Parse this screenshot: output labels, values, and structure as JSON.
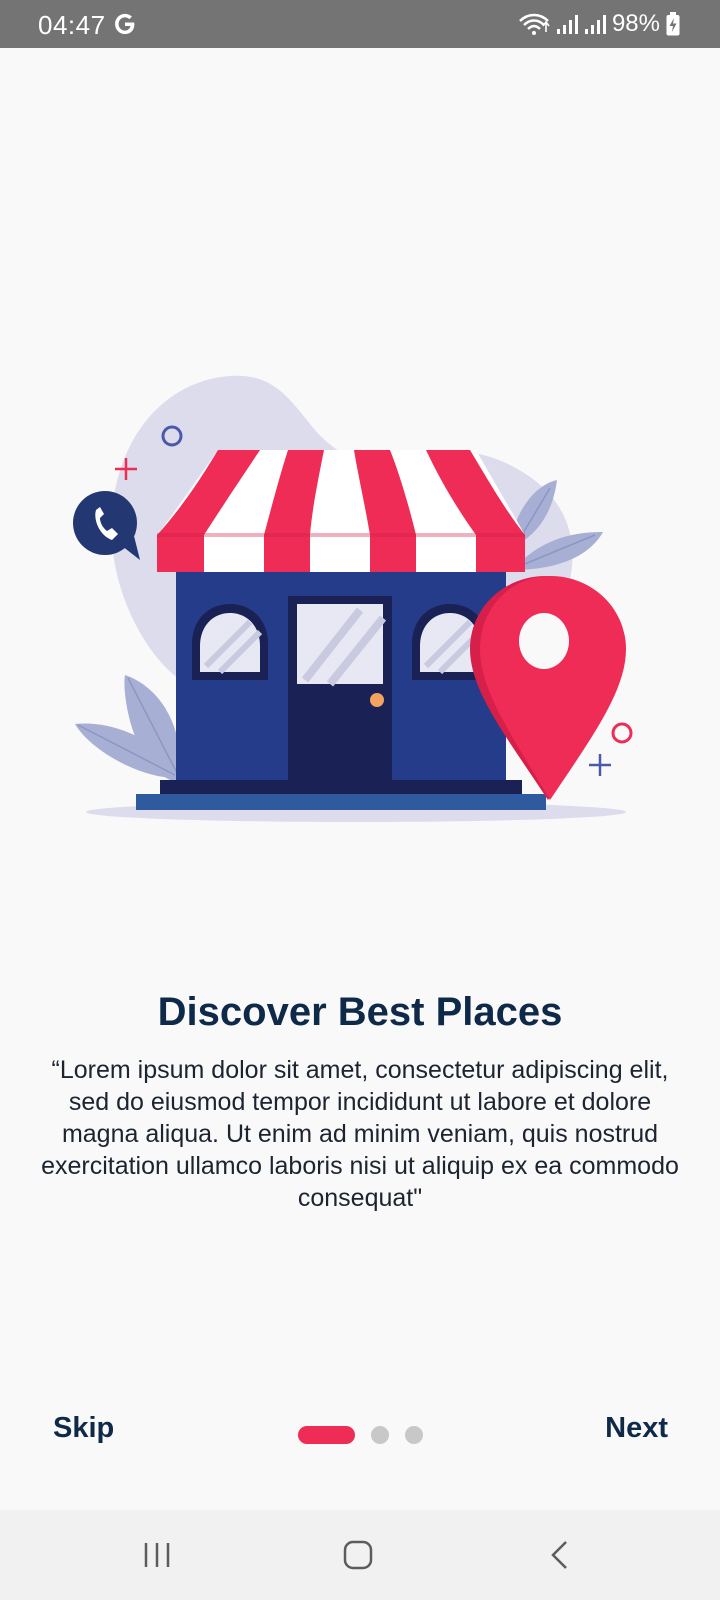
{
  "status_bar": {
    "time": "04:47",
    "carrier_icon": "google-g-icon",
    "battery_percent": "98%",
    "icons": [
      "wifi-icon",
      "signal-icon",
      "signal-icon",
      "battery-charging-icon"
    ]
  },
  "onboarding": {
    "illustration": "storefront-with-map-pin",
    "title": "Discover Best Places",
    "description": "“Lorem ipsum dolor sit amet, consectetur adipiscing elit, sed do eiusmod tempor incididunt ut labore et dolore magna aliqua. Ut enim ad minim veniam, quis nostrud exercitation ullamco laboris nisi ut aliquip ex ea commodo consequat\"",
    "skip_label": "Skip",
    "next_label": "Next",
    "page_indicator": {
      "current": 1,
      "total": 3
    }
  },
  "nav_bar": {
    "buttons": [
      "recent-apps-icon",
      "home-icon",
      "back-icon"
    ]
  },
  "colors": {
    "accent": "#ef2c56",
    "navy": "#0f2a48",
    "shop_blue": "#243c8a",
    "status_bar": "#747474"
  }
}
